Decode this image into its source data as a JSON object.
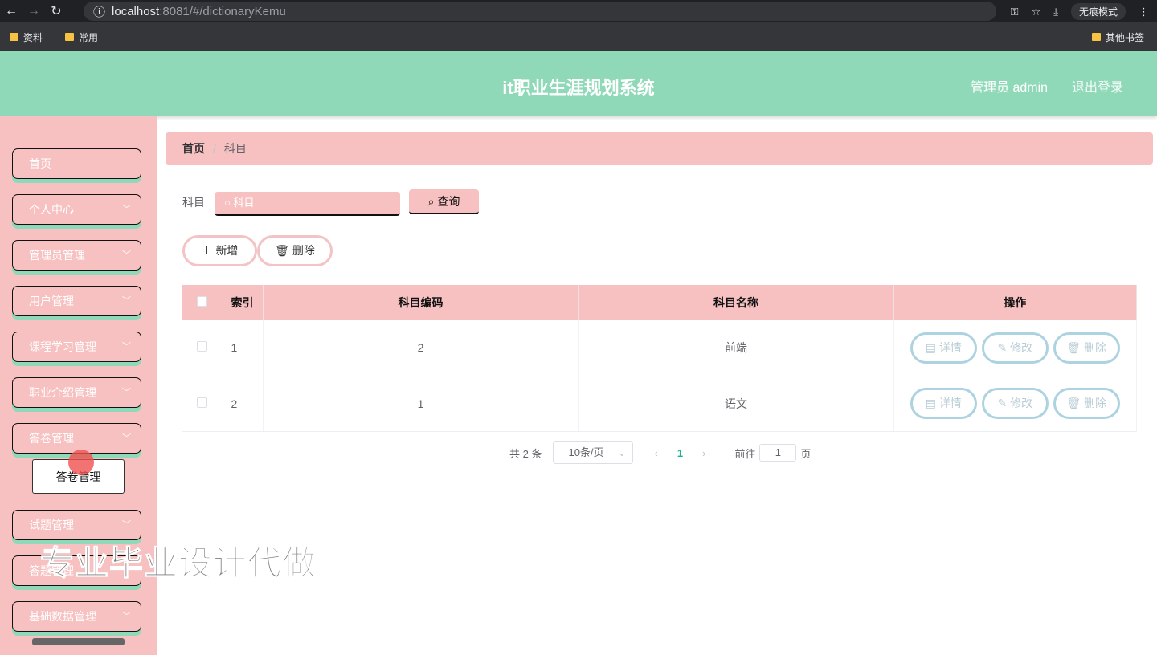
{
  "browser": {
    "host": "localhost",
    "path": ":8081/#/dictionaryKemu",
    "incognito": "无痕模式",
    "bookmarks": [
      "资料",
      "常用"
    ],
    "other_bookmarks": "其他书签"
  },
  "header": {
    "title": "it职业生涯规划系统",
    "user": "管理员 admin",
    "logout": "退出登录"
  },
  "sidebar": {
    "items": [
      {
        "label": "首页"
      },
      {
        "label": "个人中心"
      },
      {
        "label": "管理员管理"
      },
      {
        "label": "用户管理"
      },
      {
        "label": "课程学习管理"
      },
      {
        "label": "职业介绍管理"
      },
      {
        "label": "答卷管理"
      },
      {
        "label": "试题管理"
      },
      {
        "label": "答题管理"
      },
      {
        "label": "基础数据管理"
      }
    ],
    "submenu": "答卷管理"
  },
  "breadcrumb": {
    "home": "首页",
    "current": "科目"
  },
  "search": {
    "label": "科目",
    "placeholder": "科目",
    "button": "查询"
  },
  "actions": {
    "add": "新增",
    "delete": "删除"
  },
  "table": {
    "headers": [
      "索引",
      "科目编码",
      "科目名称",
      "操作"
    ],
    "rows": [
      {
        "index": "1",
        "code": "2",
        "name": "前端"
      },
      {
        "index": "2",
        "code": "1",
        "name": "语文"
      }
    ],
    "row_actions": {
      "detail": "详情",
      "edit": "修改",
      "delete": "删除"
    }
  },
  "pagination": {
    "total": "共 2 条",
    "page_size": "10条/页",
    "current": "1",
    "goto": "前往",
    "goto_value": "1",
    "page_suffix": "页"
  },
  "watermark": "专业毕业设计代做"
}
